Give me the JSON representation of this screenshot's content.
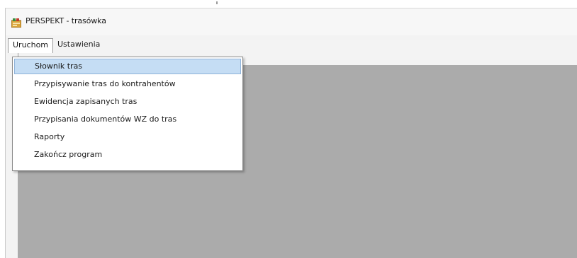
{
  "window": {
    "title": "PERSPEKT - trasówka"
  },
  "menubar": {
    "items": [
      {
        "label": "Uruchom"
      },
      {
        "label": "Ustawienia"
      }
    ]
  },
  "dropdown": {
    "items": [
      {
        "label": "Słownik tras"
      },
      {
        "label": "Przypisywanie tras do kontrahentów"
      },
      {
        "label": "Ewidencja zapisanych tras"
      },
      {
        "label": "Przypisania dokumentów WZ do tras"
      },
      {
        "label": "Raporty"
      },
      {
        "label": "Zakończ program"
      }
    ]
  }
}
